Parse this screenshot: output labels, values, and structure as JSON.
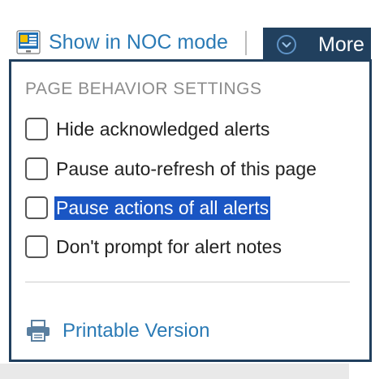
{
  "toolbar": {
    "noc_label": "Show in NOC mode",
    "noc_icon": "monitor-icon",
    "more_label": "More",
    "more_icon": "chevron-down-circle-icon"
  },
  "menu": {
    "heading": "PAGE BEHAVIOR SETTINGS",
    "options": [
      {
        "label": "Hide acknowledged alerts",
        "checked": false,
        "selected": false
      },
      {
        "label": "Pause auto-refresh of this page",
        "checked": false,
        "selected": false
      },
      {
        "label": "Pause actions of all alerts",
        "checked": false,
        "selected": true
      },
      {
        "label": "Don't prompt for alert notes",
        "checked": false,
        "selected": false
      }
    ],
    "print_label": "Printable Version",
    "print_icon": "printer-icon"
  },
  "colors": {
    "accent_blue": "#2a7ab5",
    "dropdown_border": "#21405e",
    "selection": "#1a56c4",
    "heading_gray": "#8c8c8c"
  }
}
